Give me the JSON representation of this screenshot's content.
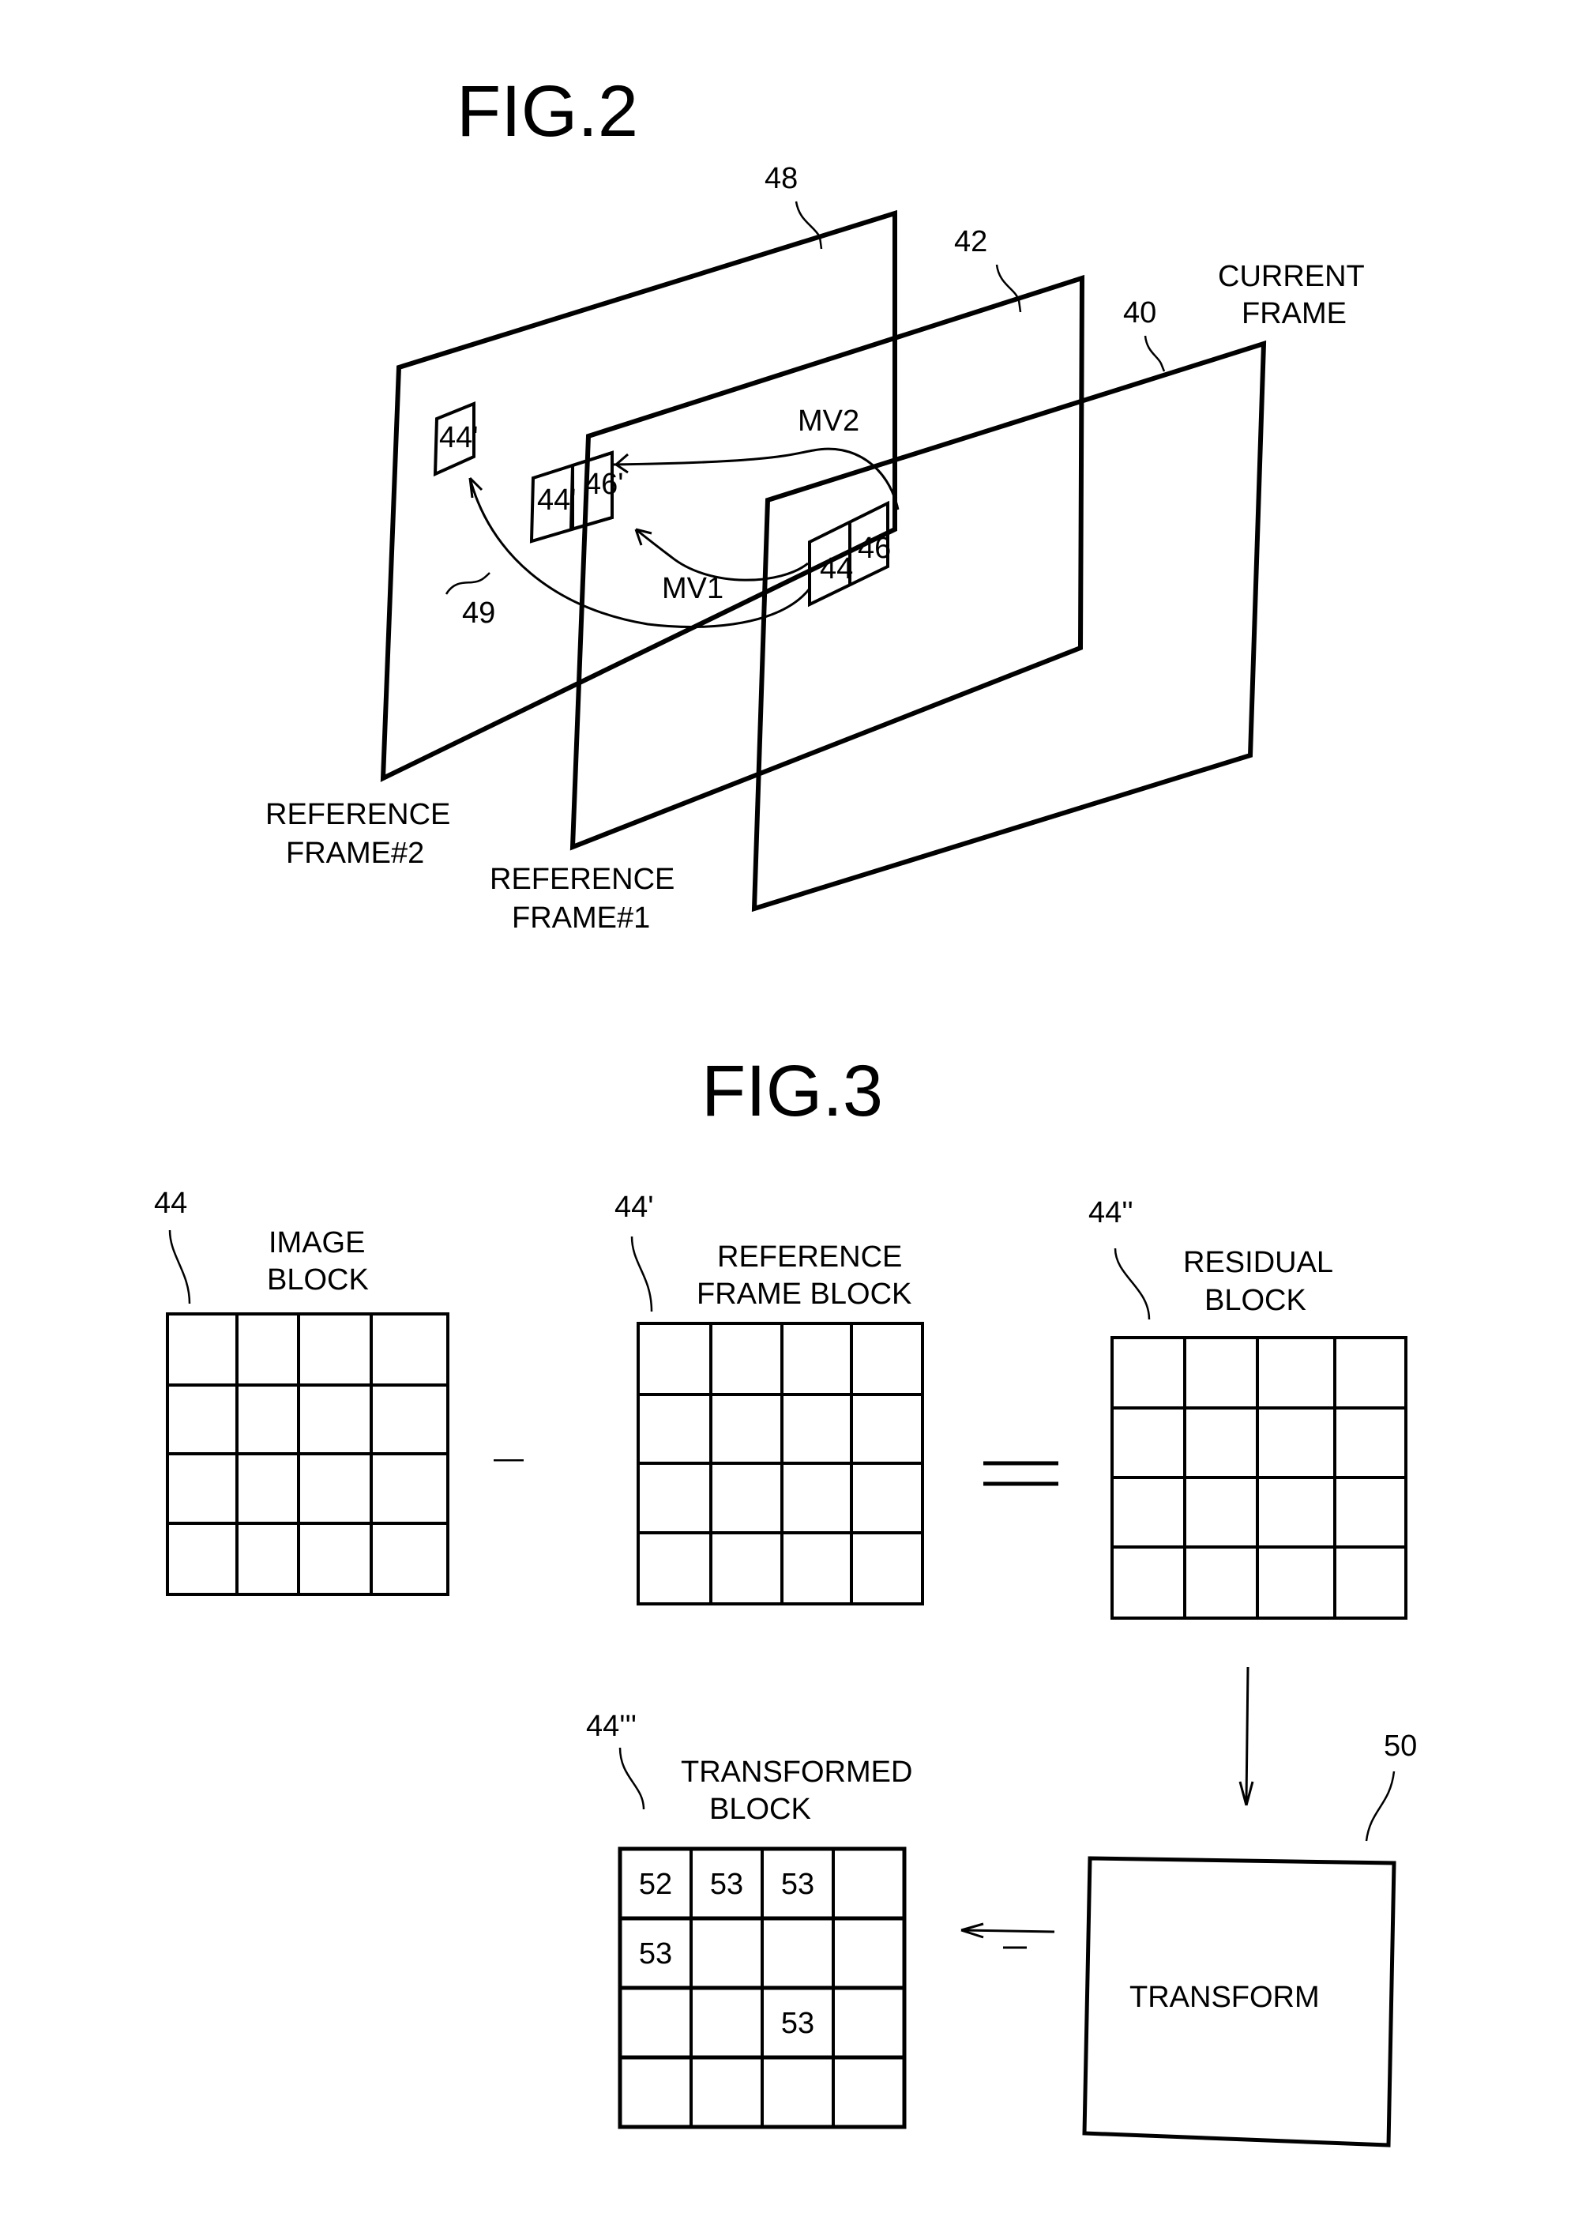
{
  "fig2": {
    "title": "FIG.2",
    "frames": {
      "reference2": {
        "ref": "48",
        "caption_line1": "REFERENCE",
        "caption_line2": "FRAME#2",
        "block": "44'"
      },
      "reference1": {
        "ref": "42",
        "caption_line1": "REFERENCE",
        "caption_line2": "FRAME#1",
        "block_a": "44'",
        "block_b": "46'"
      },
      "current": {
        "ref": "40",
        "caption_line1": "CURRENT",
        "caption_line2": "FRAME",
        "block_a": "44",
        "block_b": "46"
      }
    },
    "vectors": {
      "mv1": "MV1",
      "mv2": "MV2",
      "long_ref": "49"
    }
  },
  "fig3": {
    "title": "FIG.3",
    "image_block": {
      "ref": "44",
      "caption_line1": "IMAGE",
      "caption_line2": "BLOCK"
    },
    "minus_sign": "—",
    "reference_block": {
      "ref": "44'",
      "caption_line1": "REFERENCE",
      "caption_line2": "FRAME BLOCK"
    },
    "equals_sign": "=",
    "residual_block": {
      "ref": "44''",
      "caption_line1": "RESIDUAL",
      "caption_line2": "BLOCK"
    },
    "transform": {
      "ref": "50",
      "label": "TRANSFORM"
    },
    "transformed_block": {
      "ref": "44'''",
      "caption_line1": "TRANSFORMED",
      "caption_line2": "BLOCK",
      "cells": [
        [
          "52",
          "53",
          "53",
          ""
        ],
        [
          "53",
          "",
          "",
          ""
        ],
        [
          "",
          "",
          "53",
          ""
        ],
        [
          "",
          "",
          "",
          ""
        ]
      ]
    }
  }
}
